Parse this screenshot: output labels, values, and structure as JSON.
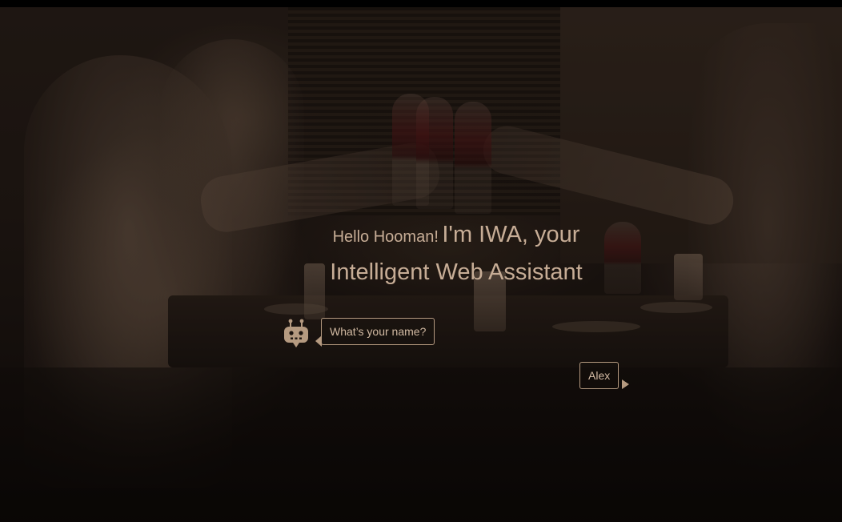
{
  "greeting": {
    "hello": "Hello Hooman!",
    "intro": "I'm IWA, your",
    "subtitle": "Intelligent Web Assistant"
  },
  "chat": {
    "bot_message": "What’s your name?",
    "user_message": "Alex"
  },
  "icons": {
    "assistant": "robot-icon"
  },
  "colors": {
    "text": "#c7ad96",
    "bubble_border": "#b59a80",
    "overlay": "#0b0806"
  }
}
